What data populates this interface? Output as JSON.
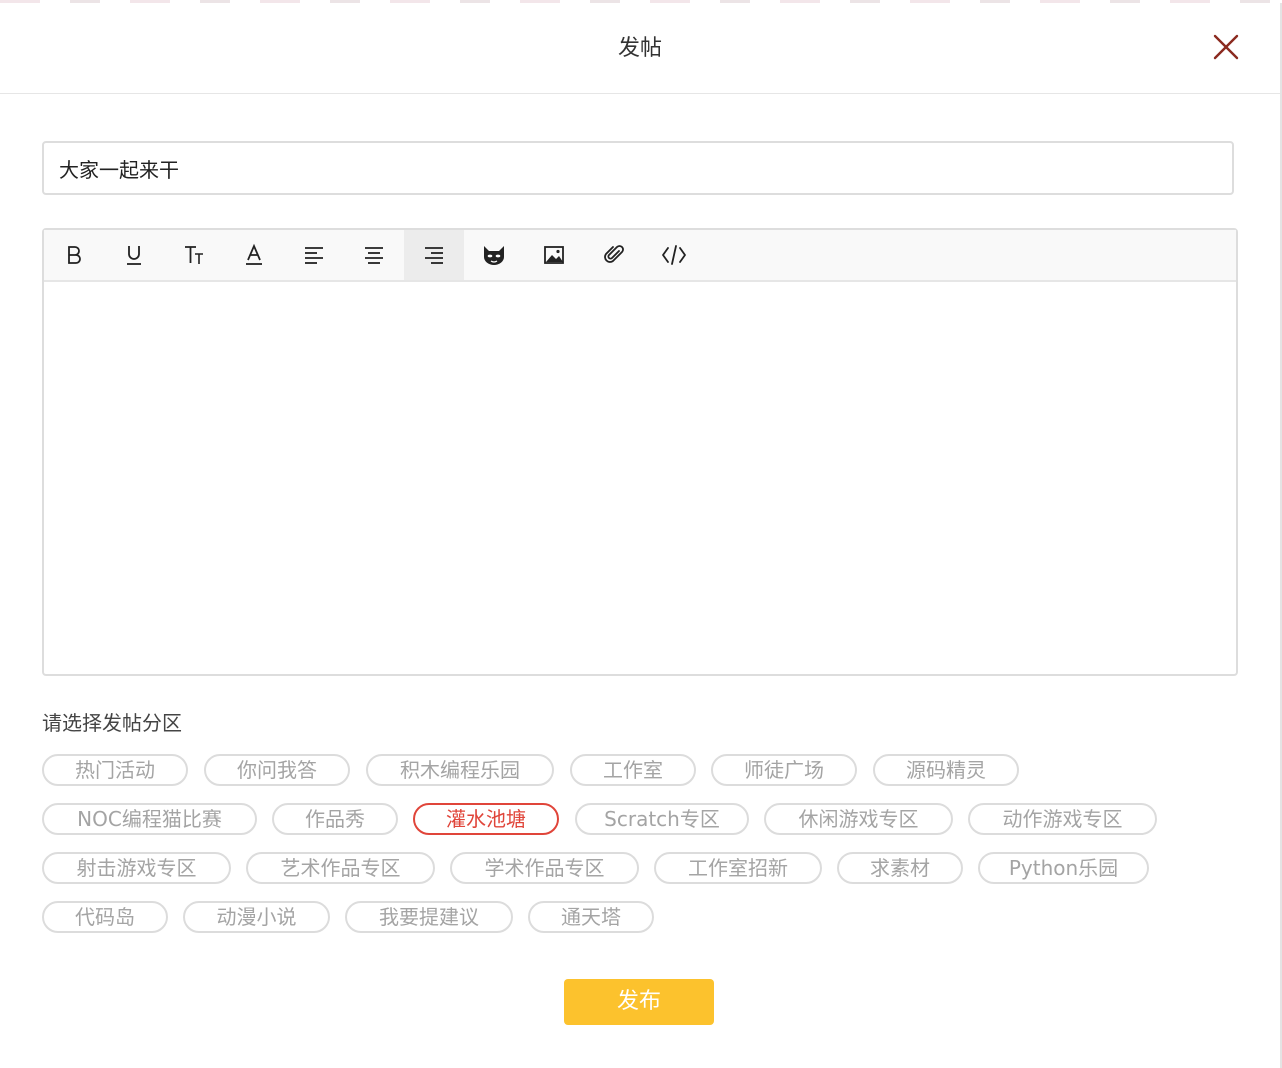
{
  "dialog": {
    "title": "发帖",
    "close_icon": "close-icon",
    "accent_color": "#8b2a1f"
  },
  "post": {
    "title_value": "大家一起来干",
    "body_value": ""
  },
  "toolbar": {
    "tools": [
      {
        "name": "bold-icon",
        "glyph": "B"
      },
      {
        "name": "underline-icon",
        "glyph": "U"
      },
      {
        "name": "font-size-icon",
        "glyph": "Tt"
      },
      {
        "name": "font-color-icon",
        "glyph": "A"
      },
      {
        "name": "align-left-icon",
        "glyph": ""
      },
      {
        "name": "align-center-icon",
        "glyph": ""
      },
      {
        "name": "align-right-icon",
        "glyph": "",
        "active": true
      },
      {
        "name": "emoji-cat-icon",
        "glyph": ""
      },
      {
        "name": "image-icon",
        "glyph": ""
      },
      {
        "name": "attachment-icon",
        "glyph": ""
      },
      {
        "name": "code-icon",
        "glyph": ""
      }
    ]
  },
  "section": {
    "label": "请选择发帖分区",
    "selected": "灌水池塘",
    "selected_color": "#e0453a",
    "tags": [
      "热门活动",
      "你问我答",
      "积木编程乐园",
      "工作室",
      "师徒广场",
      "源码精灵",
      "NOC编程猫比赛",
      "作品秀",
      "灌水池塘",
      "Scratch专区",
      "休闲游戏专区",
      "动作游戏专区",
      "射击游戏专区",
      "艺术作品专区",
      "学术作品专区",
      "工作室招新",
      "求素材",
      "Python乐园",
      "代码岛",
      "动漫小说",
      "我要提建议",
      "通天塔"
    ]
  },
  "actions": {
    "publish_label": "发布",
    "publish_color": "#fcc22d"
  }
}
